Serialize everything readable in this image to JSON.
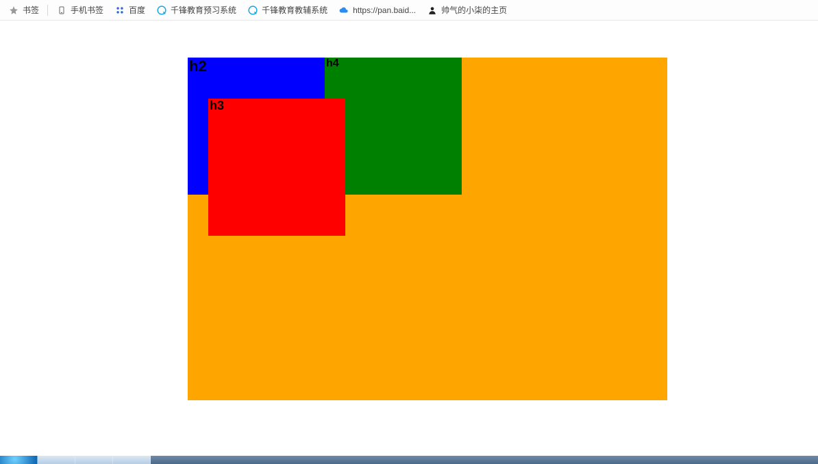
{
  "bookmarkBar": {
    "items": [
      {
        "label": "书签",
        "iconColor": "#999",
        "iconType": "star"
      },
      {
        "label": "手机书签",
        "iconColor": "#666",
        "iconType": "phone"
      },
      {
        "label": "百度",
        "iconColor": "#2f6bd0",
        "iconType": "paw"
      },
      {
        "label": "千锋教育预习系统",
        "iconColor": "#17a6e6",
        "iconType": "q"
      },
      {
        "label": "千锋教育教辅系统",
        "iconColor": "#17a6e6",
        "iconType": "q"
      },
      {
        "label": "https://pan.baid...",
        "iconColor": "#2a8ef0",
        "iconType": "cloud"
      },
      {
        "label": "帅气的小柒的主页",
        "iconColor": "#222",
        "iconType": "person"
      }
    ],
    "separatorAfter": [
      0
    ]
  },
  "boxes": {
    "h2": "h2",
    "h3": "h3",
    "h4": "h4"
  },
  "colors": {
    "h1": "orange",
    "h2": "blue",
    "h3": "red",
    "h4": "green"
  }
}
